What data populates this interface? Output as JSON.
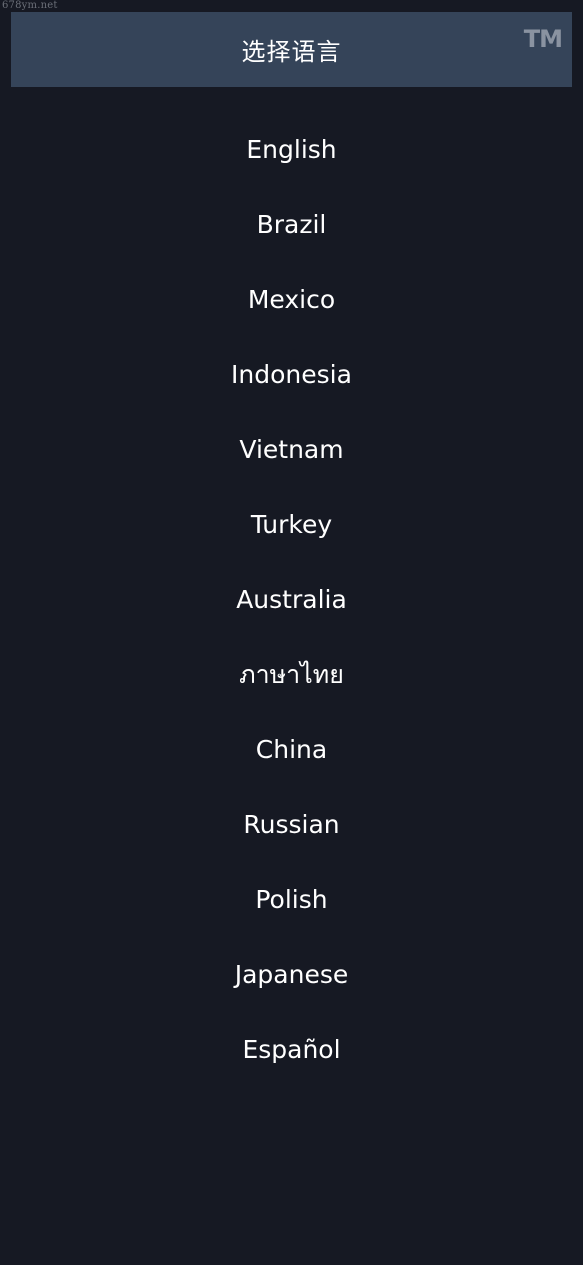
{
  "watermark": "678ym.net",
  "header": {
    "title": "选择语言",
    "logo_text": "TM"
  },
  "languages": [
    {
      "label": "English"
    },
    {
      "label": "Brazil"
    },
    {
      "label": "Mexico"
    },
    {
      "label": "Indonesia"
    },
    {
      "label": "Vietnam"
    },
    {
      "label": "Turkey"
    },
    {
      "label": "Australia"
    },
    {
      "label": "ภาษาไทย"
    },
    {
      "label": "China"
    },
    {
      "label": "Russian"
    },
    {
      "label": "Polish"
    },
    {
      "label": "Japanese"
    },
    {
      "label": "Español"
    }
  ],
  "colors": {
    "background": "#161923",
    "header_background": "#354459",
    "text": "#ffffff",
    "logo": "#8a93a1"
  }
}
